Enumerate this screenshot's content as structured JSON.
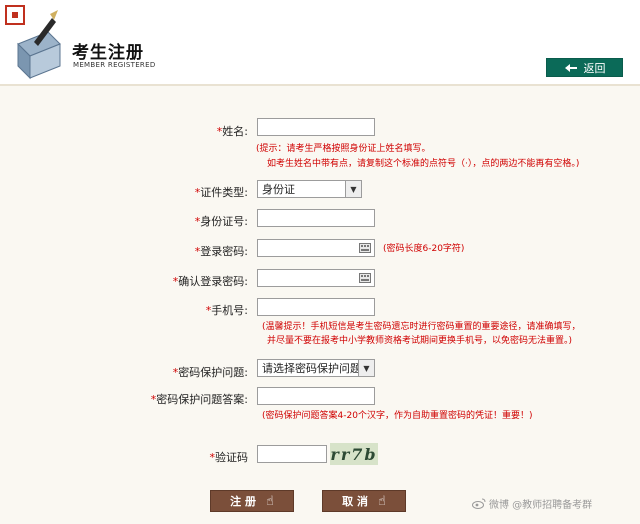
{
  "header": {
    "title": "考生注册",
    "subtitle": "MEMBER REGISTERED",
    "back_label": "返回"
  },
  "form": {
    "name": {
      "label": "姓名:",
      "value": ""
    },
    "name_hint_1": "(提示：请考生严格按照身份证上姓名填写。",
    "name_hint_2": "如考生姓名中带有点，请复制这个标准的点符号（·），点的两边不能再有空格。)",
    "id_type": {
      "label": "证件类型:",
      "value": "身份证"
    },
    "id_number": {
      "label": "身份证号:",
      "value": ""
    },
    "password": {
      "label": "登录密码:",
      "value": "",
      "hint": "(密码长度6-20字符)"
    },
    "password_confirm": {
      "label": "确认登录密码:",
      "value": ""
    },
    "phone": {
      "label": "手机号:",
      "value": ""
    },
    "phone_hint_1": "(温馨提示！手机短信是考生密码遗忘时进行密码重置的重要途径，请准确填写，",
    "phone_hint_2": "并尽量不要在报考中小学教师资格考试期间更换手机号，以免密码无法重置。)",
    "security_question": {
      "label": "密码保护问题:",
      "value": "请选择密码保护问题"
    },
    "security_answer": {
      "label": "密码保护问题答案:",
      "value": "",
      "hint": "(密码保护问题答案4-20个汉字，作为自助重置密码的凭证！重要！)"
    },
    "captcha": {
      "label": "验证码",
      "value": "",
      "image_text": "rr7b"
    }
  },
  "buttons": {
    "register": "注 册",
    "cancel": "取 消"
  },
  "watermark": "微博 @教师招聘备考群"
}
